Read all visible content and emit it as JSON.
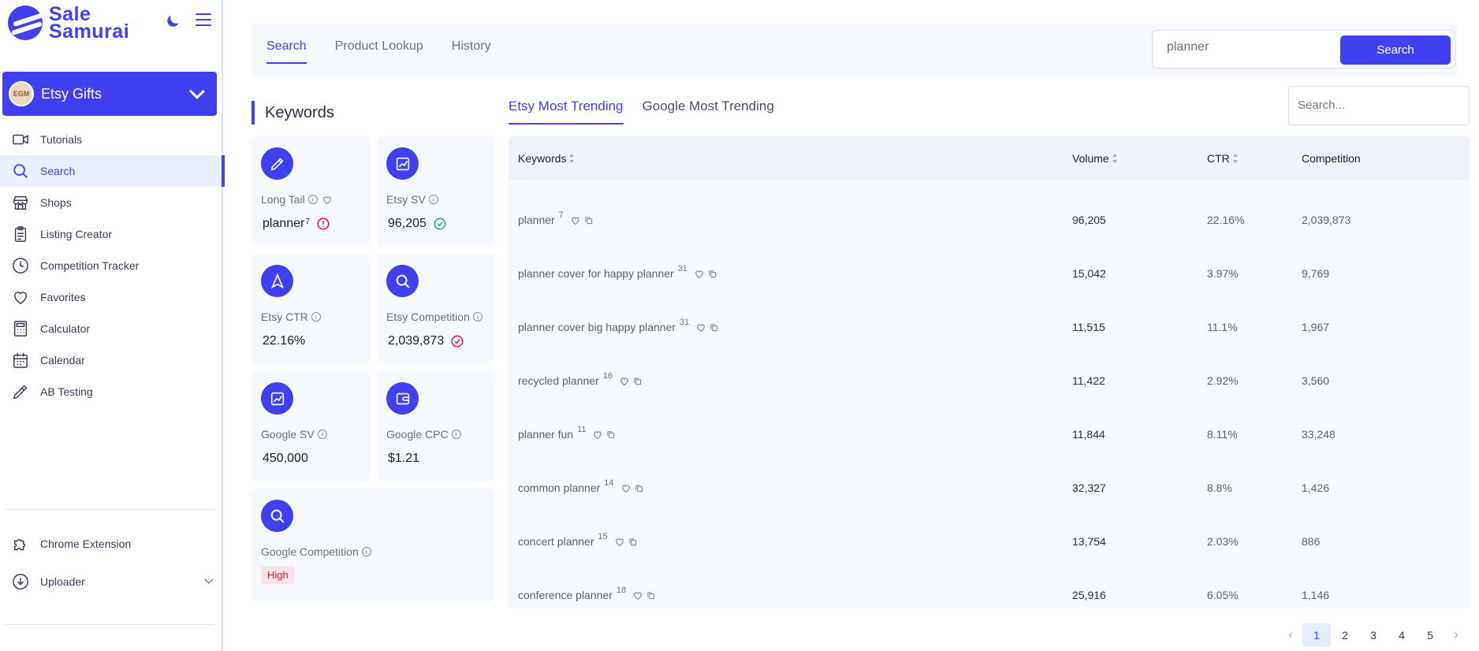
{
  "brand": {
    "line1": "Sale",
    "line2": "Samurai"
  },
  "shop": {
    "name": "Etsy Gifts",
    "avatar_text": "EGM"
  },
  "sidebar": {
    "items": [
      {
        "label": "Tutorials",
        "icon": "video-icon"
      },
      {
        "label": "Search",
        "icon": "search-icon",
        "active": true
      },
      {
        "label": "Shops",
        "icon": "store-icon"
      },
      {
        "label": "Listing Creator",
        "icon": "clipboard-icon"
      },
      {
        "label": "Competition Tracker",
        "icon": "clock-icon"
      },
      {
        "label": "Favorites",
        "icon": "heart-icon"
      },
      {
        "label": "Calculator",
        "icon": "calculator-icon"
      },
      {
        "label": "Calendar",
        "icon": "calendar-icon"
      },
      {
        "label": "AB Testing",
        "icon": "pen-icon"
      }
    ],
    "chrome_extension": "Chrome Extension",
    "uploader": "Uploader"
  },
  "top": {
    "tabs": [
      "Search",
      "Product Lookup",
      "History"
    ],
    "active_tab": "Search",
    "search_value": "planner",
    "search_button": "Search"
  },
  "keywords": {
    "title": "Keywords",
    "cards": {
      "long_tail": {
        "label": "Long Tail",
        "value": "planner",
        "sup": "7"
      },
      "etsy_sv": {
        "label": "Etsy SV",
        "value": "96,205"
      },
      "etsy_ctr": {
        "label": "Etsy CTR",
        "value": "22.16%"
      },
      "etsy_competition": {
        "label": "Etsy Competition",
        "value": "2,039,873"
      },
      "google_sv": {
        "label": "Google SV",
        "value": "450,000"
      },
      "google_cpc": {
        "label": "Google CPC",
        "value": "$1.21"
      },
      "google_competition": {
        "label": "Google Competition",
        "value": "High"
      }
    }
  },
  "trending": {
    "tabs": [
      "Etsy Most Trending",
      "Google Most Trending"
    ],
    "active_tab": "Etsy Most Trending",
    "search_placeholder": "Search...",
    "columns": [
      "Keywords",
      "Volume",
      "CTR",
      "Competition"
    ],
    "rows": [
      {
        "keyword": "planner",
        "count": "7",
        "volume": "96,205",
        "ctr": "22.16%",
        "competition": "2,039,873"
      },
      {
        "keyword": "planner cover for happy planner",
        "count": "31",
        "volume": "15,042",
        "ctr": "3.97%",
        "competition": "9,769"
      },
      {
        "keyword": "planner cover big happy planner",
        "count": "31",
        "volume": "11,515",
        "ctr": "11.1%",
        "competition": "1,967"
      },
      {
        "keyword": "recycled planner",
        "count": "16",
        "volume": "11,422",
        "ctr": "2.92%",
        "competition": "3,560"
      },
      {
        "keyword": "planner fun",
        "count": "11",
        "volume": "11,844",
        "ctr": "8.11%",
        "competition": "33,248"
      },
      {
        "keyword": "common planner",
        "count": "14",
        "volume": "32,327",
        "ctr": "8.8%",
        "competition": "1,426"
      },
      {
        "keyword": "concert planner",
        "count": "15",
        "volume": "13,754",
        "ctr": "2.03%",
        "competition": "886"
      },
      {
        "keyword": "conference planner",
        "count": "18",
        "volume": "25,916",
        "ctr": "6.05%",
        "competition": "1,146"
      }
    ]
  },
  "pagination": {
    "pages": [
      "1",
      "2",
      "3",
      "4",
      "5"
    ],
    "current": "1",
    "prev": "‹",
    "next": "›"
  },
  "colors": {
    "accent": "#4040f0",
    "danger": "#e0114d",
    "success": "#19b36b",
    "panel": "#f6f9fd"
  }
}
